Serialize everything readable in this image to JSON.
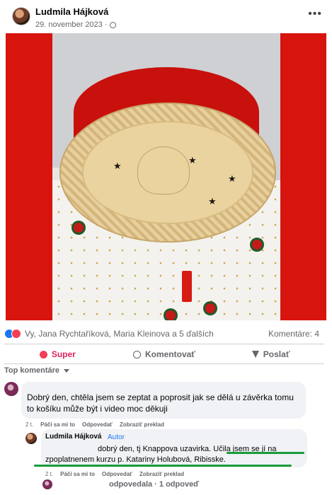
{
  "post": {
    "author": "Ludmila Hájková",
    "date": "29. november 2023 ·",
    "more_icon": "more-horizontal-icon"
  },
  "photo": {
    "description_icon": "christmas-basket-photo"
  },
  "reactions": {
    "names": "Vy, Jana Rychtaříková, Maria Kleinova a 5 ďalších",
    "comments_count": "Komentáre: 4"
  },
  "actions": {
    "super": "Super",
    "comment": "Komentovať",
    "share": "Poslať"
  },
  "top_comments_label": "Top komentáre",
  "comment1": {
    "text": "Dobrý den, chtěla jsem se zeptat a poprosit jak se dělá u závěrka tomu to košíku může být i video moc děkuji",
    "time": "2 t.",
    "like": "Páči sa mi to",
    "reply": "Odpovedať",
    "translate": "Zobraziť preklad"
  },
  "reply1": {
    "author": "Ludmila Hájková",
    "badge": "Autor",
    "line1": "dobrý den, tj Knappova uzavirka. Učila jsem se jí na",
    "line2": "zpoplatnenem kurzu p. Katariny Holubová, Ribisske.",
    "time": "2 t.",
    "like": "Páči sa mi to",
    "reply": "Odpovedať",
    "translate": "Zobraziť preklad"
  },
  "replies_summary": "odpovedala · 1 odpoveď",
  "colors": {
    "accent": "#1877f2",
    "super": "#e0245e",
    "highlight": "#1a9b3b",
    "photo_background": "#d8140e"
  }
}
